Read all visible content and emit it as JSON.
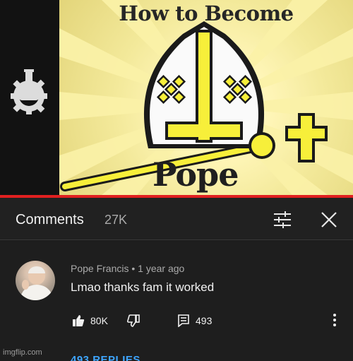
{
  "video": {
    "thumbnail_title": "How to Become",
    "thumbnail_word": "Pope",
    "progress_percent": 100,
    "progress_color": "#e02020",
    "channel_icon": "gear-flask-icon"
  },
  "comments": {
    "title": "Comments",
    "count": "27K",
    "filter_icon": "sliders-icon",
    "close_icon": "close-icon"
  },
  "comment": {
    "author": "Pope Francis",
    "separator": "•",
    "time": "1 year ago",
    "text": "Lmao thanks fam it worked",
    "likes": "80K",
    "replies_count": "493",
    "replies_link": "493 REPLIES",
    "accent": "#3ea6ff"
  },
  "watermark": "imgflip.com"
}
